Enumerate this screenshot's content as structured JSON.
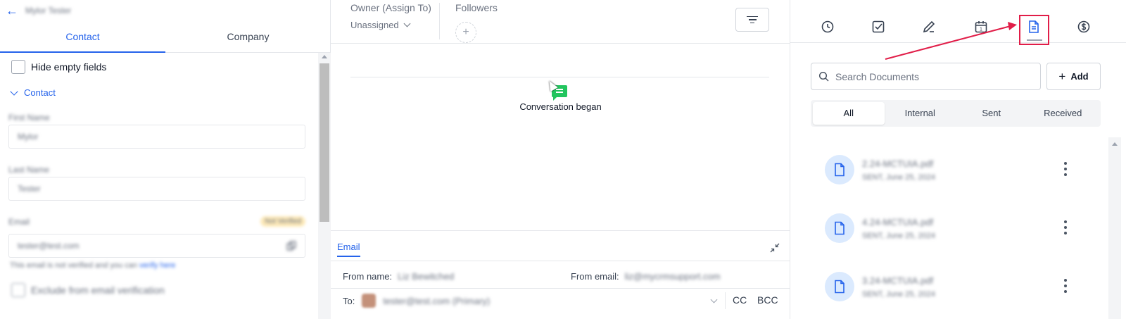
{
  "left_panel": {
    "back_icon": "arrow-left-icon",
    "contact_name": "Mylor Tester",
    "tabs": [
      {
        "label": "Contact",
        "active": true
      },
      {
        "label": "Company",
        "active": false
      }
    ],
    "hide_empty_label": "Hide empty fields",
    "section_label": "Contact",
    "fields": {
      "first_name": {
        "label": "First Name",
        "value": "Mylor"
      },
      "last_name": {
        "label": "Last Name",
        "value": "Tester"
      },
      "email": {
        "label": "Email",
        "value": "tester@test.com",
        "badge": "Not Verified"
      }
    },
    "email_hint": "This email is not verified and you can",
    "email_hint_link": "verify here",
    "exclude_label": "Exclude from email verification"
  },
  "center_panel": {
    "owner_label": "Owner (Assign To)",
    "owner_value": "Unassigned",
    "followers_label": "Followers",
    "add_follower": "+",
    "filter_icon": "filter-icon",
    "conversation_event": "Conversation began",
    "composer": {
      "tab_label": "Email",
      "from_name_label": "From name:",
      "from_name_value": "Liz Bewitched",
      "from_email_label": "From email:",
      "from_email_value": "liz@mycrmsupport.com",
      "to_label": "To:",
      "to_value": "tester@test.com (Primary)",
      "cc_label": "CC",
      "bcc_label": "BCC"
    }
  },
  "right_panel": {
    "icons": [
      "activity-icon",
      "tasks-icon",
      "notes-icon",
      "calendar-icon",
      "documents-icon",
      "payments-icon"
    ],
    "active_icon": "documents-icon",
    "calendar_day": "1",
    "search_placeholder": "Search Documents",
    "add_label": "Add",
    "filter_tabs": [
      {
        "label": "All",
        "active": true
      },
      {
        "label": "Internal",
        "active": false
      },
      {
        "label": "Sent",
        "active": false
      },
      {
        "label": "Received",
        "active": false
      }
    ],
    "documents": [
      {
        "name": "2.24-MCTUIA.pdf",
        "meta": "SENT, June 25, 2024"
      },
      {
        "name": "4.24-MCTUIA.pdf",
        "meta": "SENT, June 25, 2024"
      },
      {
        "name": "3.24-MCTUIA.pdf",
        "meta": "SENT, June 25, 2024"
      }
    ]
  },
  "colors": {
    "accent": "#2563eb",
    "highlight": "#e11d48",
    "chat_green": "#22c55e"
  }
}
